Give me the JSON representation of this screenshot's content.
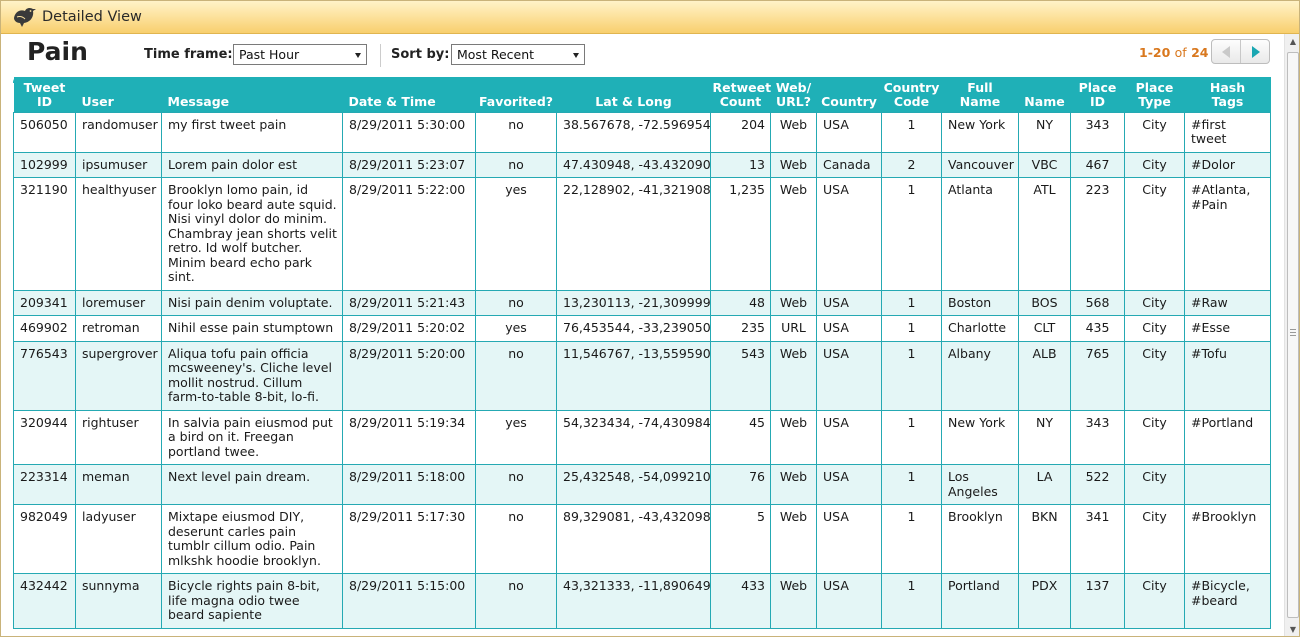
{
  "window": {
    "title": "Detailed View",
    "icon": "bird-icon"
  },
  "page": {
    "title": "Pain"
  },
  "filters": {
    "time_frame_label": "Time frame:",
    "time_frame_value": "Past Hour",
    "sort_by_label": "Sort by:",
    "sort_by_value": "Most Recent"
  },
  "pagination": {
    "range": "1-20",
    "of": "of",
    "total": "24"
  },
  "colors": {
    "accent": "#1fb0b7",
    "alt_row": "#e4f6f6",
    "title_bar": "#fde3a0",
    "pager_text": "#d9781e"
  },
  "table": {
    "headers": [
      [
        "Tweet",
        "ID"
      ],
      [
        "",
        "User"
      ],
      [
        "",
        "Message"
      ],
      [
        "",
        "Date & Time"
      ],
      [
        "",
        "Favorited?"
      ],
      [
        "",
        "Lat & Long"
      ],
      [
        "Retweet",
        "Count"
      ],
      [
        "Web/",
        "URL?"
      ],
      [
        "",
        "Country"
      ],
      [
        "Country",
        "Code"
      ],
      [
        "Full",
        "Name"
      ],
      [
        "",
        "Name"
      ],
      [
        "Place",
        "ID"
      ],
      [
        "Place",
        "Type"
      ],
      [
        "Hash",
        "Tags"
      ]
    ],
    "rows": [
      [
        "506050",
        "randomuser",
        "my first tweet pain",
        "8/29/2011 5:30:00",
        "no",
        "38.567678, -72.596954",
        "204",
        "Web",
        "USA",
        "1",
        "New York",
        "NY",
        "343",
        "City",
        "#first tweet"
      ],
      [
        "102999",
        "ipsumuser",
        "Lorem pain dolor est",
        "8/29/2011 5:23:07",
        "no",
        "47.430948, -43.432090",
        "13",
        "Web",
        "Canada",
        "2",
        "Vancouver",
        "VBC",
        "467",
        "City",
        "#Dolor"
      ],
      [
        "321190",
        "healthyuser",
        "Brooklyn lomo pain, id four loko beard aute squid. Nisi vinyl dolor do minim. Chambray jean shorts velit retro. Id wolf butcher. Minim beard echo park sint.",
        "8/29/2011 5:22:00",
        "yes",
        "22,128902, -41,321908",
        "1,235",
        "Web",
        "USA",
        "1",
        "Atlanta",
        "ATL",
        "223",
        "City",
        "#Atlanta, #Pain"
      ],
      [
        "209341",
        "loremuser",
        "Nisi pain denim voluptate.",
        "8/29/2011 5:21:43",
        "no",
        "13,230113, -21,309999",
        "48",
        "Web",
        "USA",
        "1",
        "Boston",
        "BOS",
        "568",
        "City",
        "#Raw"
      ],
      [
        "469902",
        "retroman",
        "Nihil esse pain stumptown",
        "8/29/2011 5:20:02",
        "yes",
        "76,453544, -33,239050",
        "235",
        "URL",
        "USA",
        "1",
        "Charlotte",
        "CLT",
        "435",
        "City",
        "#Esse"
      ],
      [
        "776543",
        "supergrover",
        "Aliqua tofu pain officia mcsweeney's. Cliche level mollit nostrud. Cillum farm-to-table 8-bit, lo-fi.",
        "8/29/2011 5:20:00",
        "no",
        "11,546767, -13,559590",
        "543",
        "Web",
        "USA",
        "1",
        "Albany",
        "ALB",
        "765",
        "City",
        "#Tofu"
      ],
      [
        "320944",
        "rightuser",
        "In salvia pain eiusmod put a bird on it. Freegan portland twee.",
        "8/29/2011 5:19:34",
        "yes",
        "54,323434, -74,430984",
        "45",
        "Web",
        "USA",
        "1",
        "New York",
        "NY",
        "343",
        "City",
        "#Portland"
      ],
      [
        "223314",
        "meman",
        "Next level pain dream.",
        "8/29/2011 5:18:00",
        "no",
        "25,432548, -54,099210",
        "76",
        "Web",
        "USA",
        "1",
        "Los Angeles",
        "LA",
        "522",
        "City",
        ""
      ],
      [
        "982049",
        "ladyuser",
        "Mixtape eiusmod DIY, deserunt carles pain tumblr cillum odio. Pain mlkshk hoodie brooklyn.",
        "8/29/2011 5:17:30",
        "no",
        "89,329081, -43,432098",
        "5",
        "Web",
        "USA",
        "1",
        "Brooklyn",
        "BKN",
        "341",
        "City",
        "#Brooklyn"
      ],
      [
        "432442",
        "sunnyma",
        "Bicycle rights pain 8-bit, life magna odio twee beard sapiente",
        "8/29/2011 5:15:00",
        "no",
        "43,321333, -11,890649",
        "433",
        "Web",
        "USA",
        "1",
        "Portland",
        "PDX",
        "137",
        "City",
        "#Bicycle, #beard"
      ]
    ]
  }
}
